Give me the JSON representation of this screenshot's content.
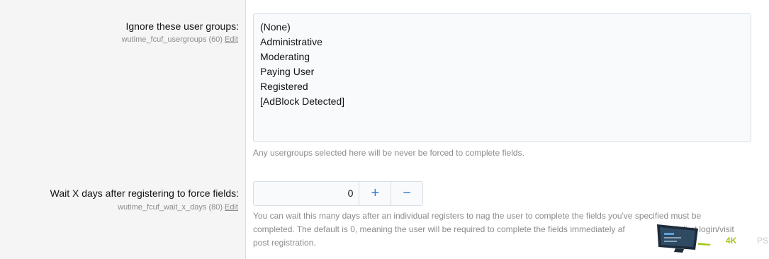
{
  "field1": {
    "label": "Ignore these user groups:",
    "hint": "wutime_fcuf_usergroups (60)",
    "edit": "Edit",
    "options": [
      "(None)",
      "Administrative",
      "Moderating",
      "Paying User",
      "Registered",
      "[AdBlock Detected]"
    ],
    "explain": "Any usergroups selected here will be never be forced to complete fields."
  },
  "field2": {
    "label": "Wait X days after registering to force fields:",
    "hint": "wutime_fcuf_wait_x_days (80)",
    "edit": "Edit",
    "value": "0",
    "plus": "+",
    "minus": "−",
    "explain_line1": "You can wait this many days after an individual registers to nag the user to complete the fields you've specified must be",
    "explain_line2": "completed. The default is 0, meaning the user will be required to complete the fields immediately af",
    "explain_line2_tail": "ir first login/visit",
    "explain_line3": "post registration."
  },
  "watermark": {
    "text1": "4K",
    "text2": "PS"
  },
  "colors": {
    "accent": "#3e7bd6",
    "watermark_green": "#a3c61b"
  }
}
